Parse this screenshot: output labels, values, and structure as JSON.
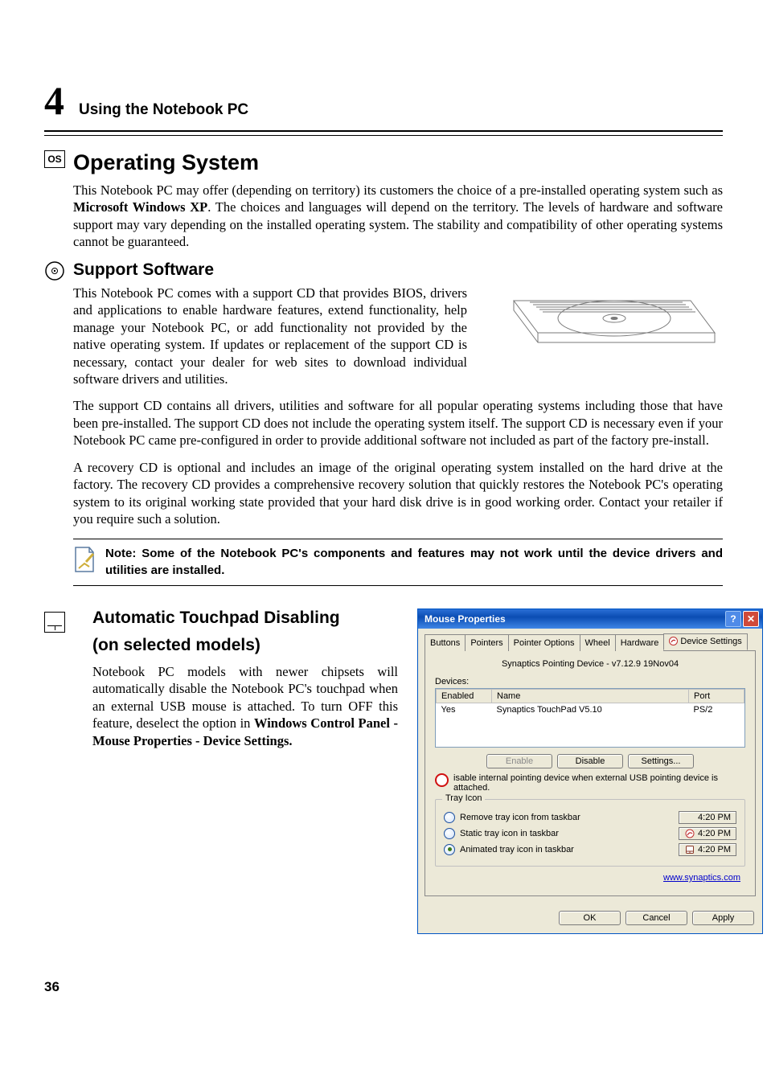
{
  "chapter": {
    "num": "4",
    "title": "Using the Notebook PC"
  },
  "os_label": "OS",
  "section_os": "Operating System",
  "p_os": "This Notebook PC may offer (depending on territory) its customers the choice of a pre-installed operating system such as ",
  "p_os_bold": "Microsoft Windows XP",
  "p_os_after": ". The choices and languages will depend on the territory. The levels of hardware and software support may vary depending on the installed operating system. The stability and compatibility of other operating systems cannot be guaranteed.",
  "section_support": "Support Software",
  "p_support1": "This Notebook PC comes with a support CD that provides BIOS, drivers and applications to enable hardware features, extend functionality, help manage your Notebook PC, or add functionality not provided by the native operating system. If updates or replacement of the support CD is necessary, contact your dealer for web sites to download individual software drivers and utilities.",
  "p_support2": "The support CD contains all drivers, utilities and software for all popular operating systems including those that have been pre-installed. The support CD does not include the operating system itself. The support CD is necessary even if your Notebook PC came pre-configured in order to provide additional software not included as part of the factory pre-install.",
  "p_support3": "A recovery CD is optional and includes an image of the original operating system installed on the hard drive at the factory. The recovery CD provides a comprehensive recovery solution that quickly restores the Notebook PC's operating system to its original working state provided that your hard disk drive is in good working order. Contact your retailer if you require such a solution.",
  "note_text": "Note: Some of the Notebook PC's components and features may not work until the device drivers and utilities are installed.",
  "section_touchpad_l1": "Automatic Touchpad Disabling",
  "section_touchpad_l2": "(on selected models)",
  "p_touch_a": "Notebook PC models with newer chipsets will automatically disable the Notebook PC's touchpad when an external USB mouse is attached. To turn OFF this feature, deselect the option in ",
  "p_touch_b": "Windows Control Panel - Mouse Properties - Device Settings.",
  "dlg": {
    "title": "Mouse Properties",
    "tabs": [
      "Buttons",
      "Pointers",
      "Pointer Options",
      "Wheel",
      "Hardware",
      "Device Settings"
    ],
    "driver": "Synaptics Pointing Device - v7.12.9 19Nov04",
    "devices_label": "Devices:",
    "table": {
      "headers": [
        "Enabled",
        "Name",
        "Port"
      ],
      "row": [
        "Yes",
        "Synaptics TouchPad V5.10",
        "PS/2"
      ]
    },
    "btn_enable": "Enable",
    "btn_disable": "Disable",
    "btn_settings": "Settings...",
    "checkbox": "isable internal pointing device when external USB pointing device is attached.",
    "tray_legend": "Tray Icon",
    "radio1": "Remove tray icon from taskbar",
    "radio2": "Static tray icon in taskbar",
    "radio3": "Animated tray icon in taskbar",
    "time": "4:20 PM",
    "link": "www.synaptics.com",
    "ok": "OK",
    "cancel": "Cancel",
    "apply": "Apply"
  },
  "page_num": "36"
}
